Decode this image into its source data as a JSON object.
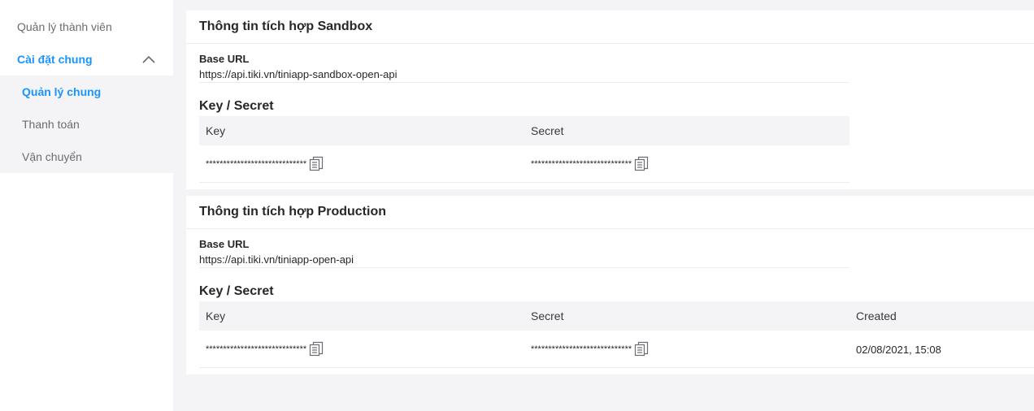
{
  "sidebar": {
    "top_item": "Quản lý thành viên",
    "group_label": "Cài đặt chung",
    "sub_items": [
      "Quản lý chung",
      "Thanh toán",
      "Vận chuyển"
    ]
  },
  "sandbox": {
    "title": "Thông tin tích hợp Sandbox",
    "base_url_label": "Base URL",
    "base_url": "https://api.tiki.vn/tiniapp-sandbox-open-api",
    "keys_title": "Key / Secret",
    "columns": [
      "Key",
      "Secret"
    ],
    "row": {
      "key": "*****************************",
      "secret": "*****************************"
    }
  },
  "production": {
    "title": "Thông tin tích hợp Production",
    "base_url_label": "Base URL",
    "base_url": "https://api.tiki.vn/tiniapp-open-api",
    "keys_title": "Key / Secret",
    "columns": [
      "Key",
      "Secret",
      "Created"
    ],
    "row": {
      "key": "*****************************",
      "secret": "*****************************",
      "created": "02/08/2021, 15:08"
    }
  },
  "colors": {
    "accent": "#1a94ff",
    "background": "#f4f4f7",
    "card": "#ffffff",
    "divider": "#ebebf0"
  },
  "icons": {
    "copy": "copy-icon",
    "collapse": "chevron-up-icon"
  }
}
